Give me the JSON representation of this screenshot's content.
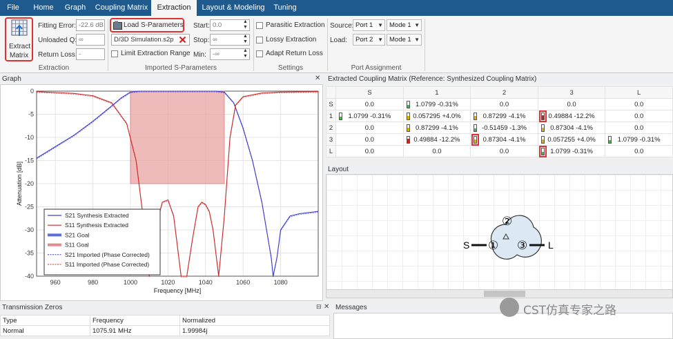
{
  "menu": {
    "tabs": [
      "File",
      "Home",
      "Graph",
      "Coupling Matrix",
      "Extraction",
      "Layout & Modeling",
      "Tuning"
    ],
    "active": "Extraction"
  },
  "ribbon": {
    "extract_label_1": "Extract",
    "extract_label_2": "Matrix",
    "fitting_error_label": "Fitting Error:",
    "fitting_error_value": "-22.6 dB",
    "unloaded_q_label": "Unloaded Q:",
    "unloaded_q_value": "∞",
    "return_loss_label": "Return Loss:",
    "return_loss_value": "-",
    "extraction_group": "Extraction",
    "load_sparams": "Load S-Parameters",
    "file_name": "D/3D Simulation.s2p",
    "limit_range": "Limit Extraction Range",
    "start_label": "Start:",
    "start_value": "0.0",
    "stop_label": "Stop:",
    "stop_value": "∞",
    "min_label": "Min:",
    "min_value": "-∞",
    "imported_group": "Imported S-Parameters",
    "parasitic": "Parasitic Extraction",
    "lossy": "Lossy Extraction",
    "adapt_rl": "Adapt Return Loss",
    "settings_group": "Settings",
    "source_label": "Source:",
    "load_label": "Load:",
    "source_port": "Port 1",
    "source_mode": "Mode 1",
    "load_port": "Port 2",
    "load_mode": "Mode 1",
    "port_group": "Port Assignment"
  },
  "graph": {
    "title": "Graph"
  },
  "chart_data": {
    "type": "line",
    "xlabel": "Frequency [MHz]",
    "ylabel": "Attenuation [dB]",
    "xlim": [
      950,
      1100
    ],
    "ylim": [
      -40,
      0
    ],
    "xticks": [
      "960",
      "980",
      "1000",
      "1020",
      "1040",
      "1060",
      "1080"
    ],
    "yticks": [
      "0",
      "-5",
      "-10",
      "-15",
      "-20",
      "-25",
      "-30",
      "-35",
      "-40"
    ],
    "goal_region": {
      "x0": 1000,
      "x1": 1050,
      "y0": -20,
      "y1": 0
    },
    "series": [
      {
        "name": "S21 Synthesis Extracted",
        "color": "#3a3ad0",
        "x": [
          950,
          960,
          970,
          980,
          990,
          995,
          1000,
          1005,
          1010,
          1015,
          1020,
          1025,
          1030,
          1035,
          1040,
          1045,
          1050,
          1055,
          1060,
          1065,
          1070,
          1075,
          1076,
          1078,
          1080,
          1085,
          1090,
          1100
        ],
        "y": [
          -14.5,
          -12,
          -9.5,
          -6.5,
          -3.2,
          -1.5,
          -0.2,
          0,
          0,
          0,
          0,
          0,
          0,
          0,
          0,
          0,
          -0.2,
          -2.5,
          -8,
          -15,
          -24,
          -36,
          -40,
          -36,
          -30,
          -27,
          -26.5,
          -26
        ]
      },
      {
        "name": "S11 Synthesis Extracted",
        "color": "#cc2828",
        "x": [
          950,
          960,
          970,
          980,
          990,
          998,
          1003,
          1007,
          1010,
          1013,
          1017,
          1020,
          1023,
          1027,
          1030,
          1033,
          1036,
          1038,
          1040,
          1042,
          1044,
          1047,
          1050,
          1053,
          1056,
          1060,
          1070,
          1080,
          1100
        ],
        "y": [
          -0.1,
          -0.3,
          -0.5,
          -1,
          -2.5,
          -7,
          -15,
          -28,
          -40,
          -30,
          -24,
          -23.5,
          -27,
          -40,
          -40,
          -32,
          -25,
          -24,
          -24.5,
          -26,
          -30,
          -40,
          -27,
          -10,
          -3,
          -1.2,
          -0.4,
          -0.2,
          -0.1
        ]
      }
    ],
    "legend": [
      "S21 Synthesis Extracted",
      "S11 Synthesis Extracted",
      "S21 Goal",
      "S11 Goal",
      "S21 Imported (Phase Corrected)",
      "S11 Imported (Phase Corrected)"
    ]
  },
  "matrix": {
    "title": "Extracted Coupling Matrix (Reference: Synthesized Coupling Matrix)",
    "cols": [
      "S",
      "1",
      "2",
      "3",
      "L"
    ],
    "rows": [
      {
        "h": "S",
        "cells": [
          "0.0",
          "1.0799 -0.31%",
          "0.0",
          "0.0",
          "0.0"
        ]
      },
      {
        "h": "1",
        "cells": [
          "1.0799 -0.31%",
          "0.057295 +4.0%",
          "0.87299 -4.1%",
          "0.49884 -12.2%",
          "0.0"
        ]
      },
      {
        "h": "2",
        "cells": [
          "0.0",
          "0.87299 -4.1%",
          "-0.51459 -1.3%",
          "0.87304 -4.1%",
          "0.0"
        ]
      },
      {
        "h": "3",
        "cells": [
          "0.0",
          "0.49884 -12.2%",
          "0.87304 -4.1%",
          "0.057255 +4.0%",
          "1.0799 -0.31%"
        ]
      },
      {
        "h": "L",
        "cells": [
          "0.0",
          "0.0",
          "0.0",
          "1.0799 -0.31%",
          "0.0"
        ]
      }
    ]
  },
  "layout": {
    "title": "Layout",
    "s": "S",
    "l": "L",
    "n1": "①",
    "n2": "②",
    "n3": "③",
    "watermark": "CST仿真专家之路"
  },
  "tz": {
    "title": "Transmission Zeros",
    "headers": [
      "Type",
      "Frequency",
      "Normalized"
    ],
    "row": [
      "Normal",
      "1075.91 MHz",
      "1.99984j"
    ]
  },
  "messages": {
    "title": "Messages"
  }
}
